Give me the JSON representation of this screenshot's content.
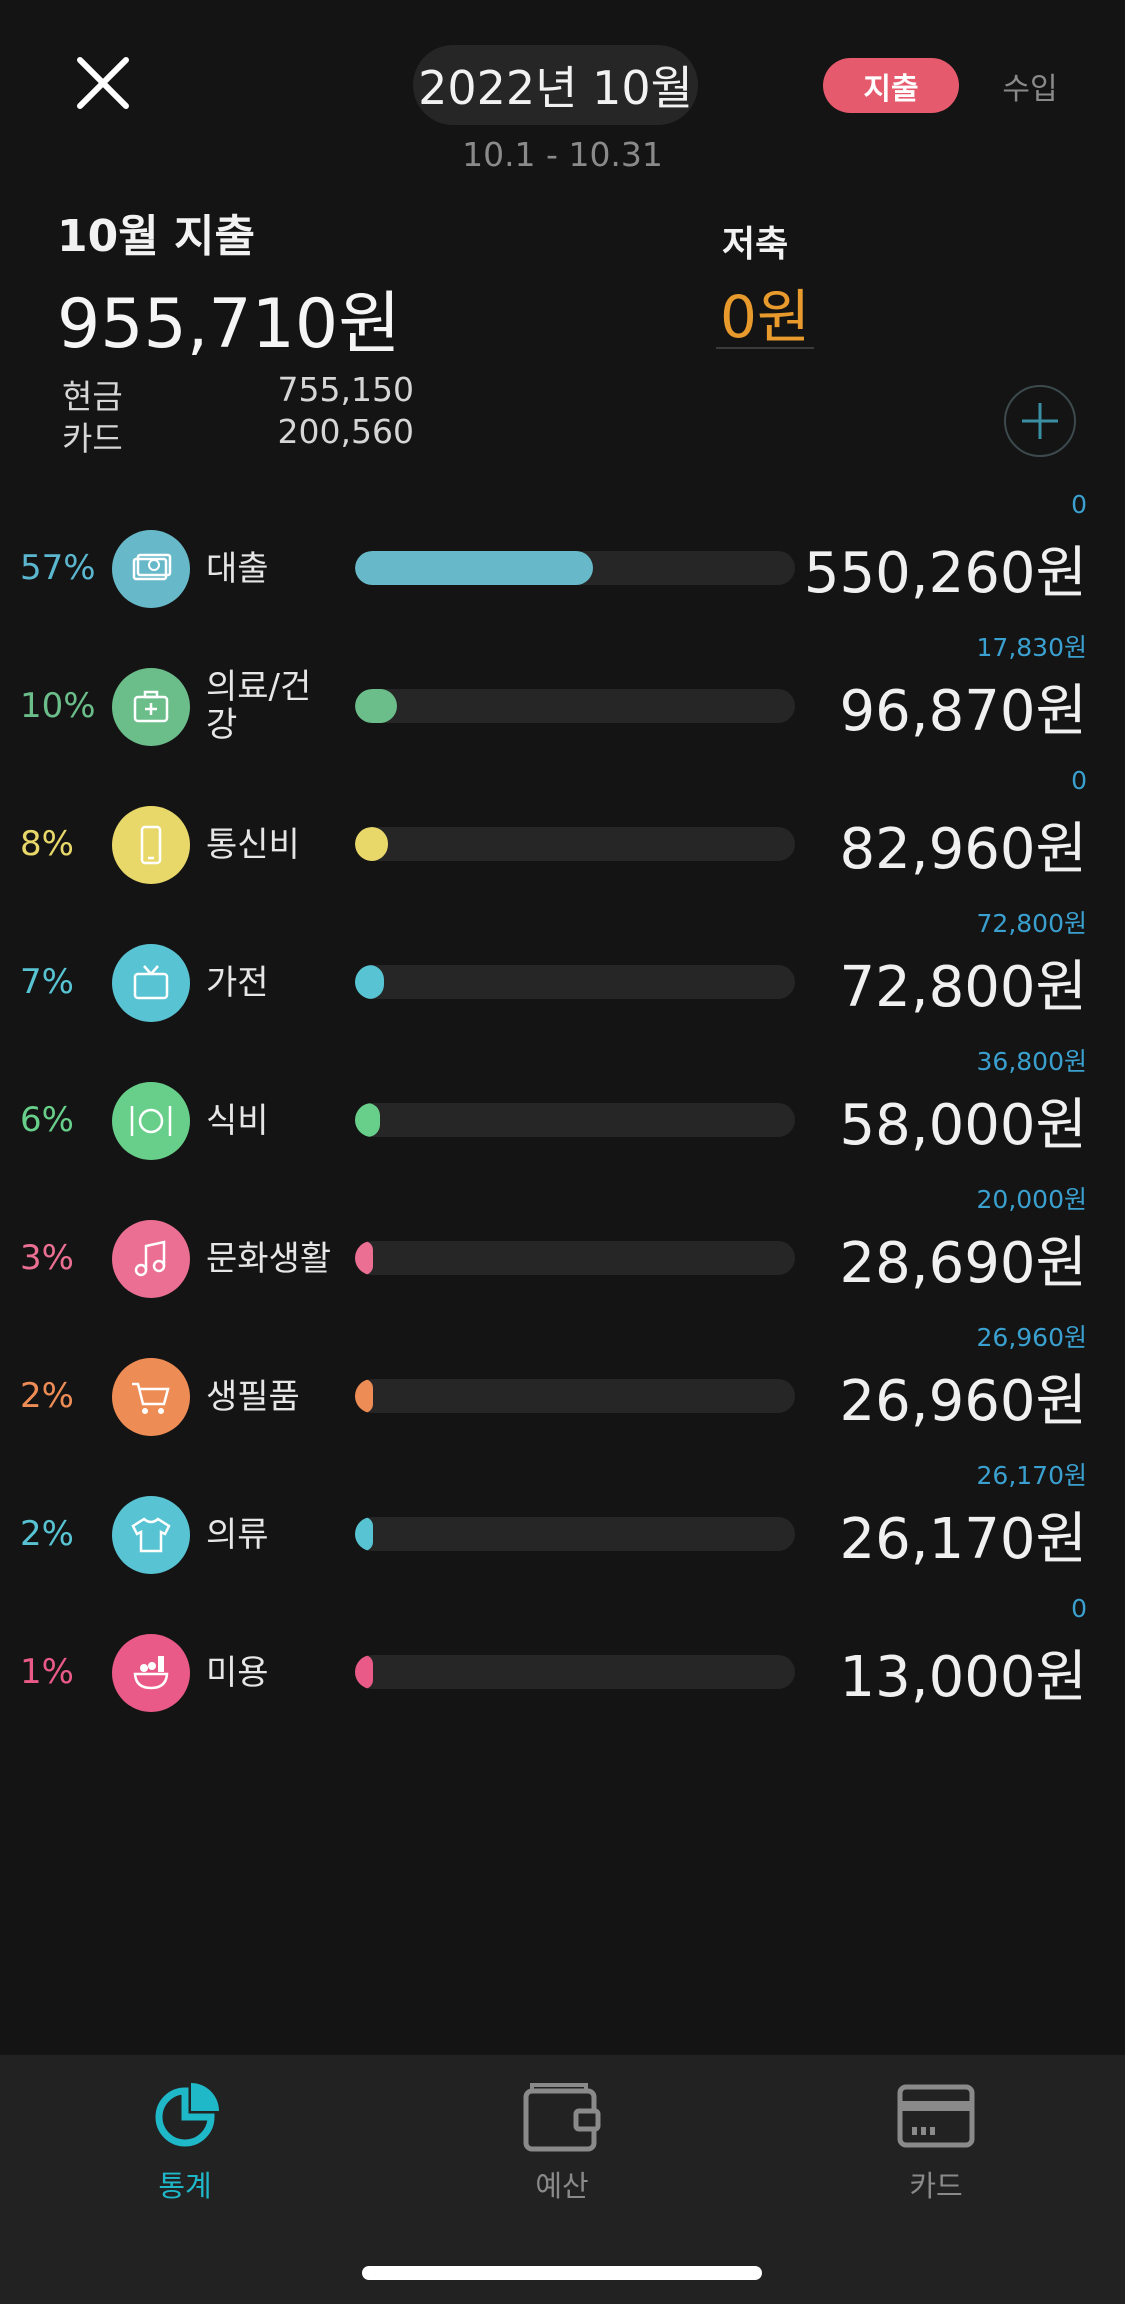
{
  "header": {
    "month": "2022년 10월",
    "date_range": "10.1 - 10.31",
    "tab_expense": "지출",
    "tab_income": "수입"
  },
  "summary": {
    "title": "10월 지출",
    "total": "955,710원",
    "cash_label": "현금",
    "cash_value": "755,150",
    "card_label": "카드",
    "card_value": "200,560",
    "savings_label": "저축",
    "savings_value": "0원"
  },
  "categories": [
    {
      "pct": "57%",
      "name": "대출",
      "budget": "0",
      "amount": "550,260원",
      "share": 0.57,
      "color": "#67b9c9",
      "pct_color": "#5bb6cf",
      "icon": "money-icon"
    },
    {
      "pct": "10%",
      "name": "의료/건강",
      "budget": "17,830원",
      "amount": "96,870원",
      "share": 0.1,
      "color": "#6bbd8a",
      "pct_color": "#6bbd8a",
      "icon": "medical-kit-icon"
    },
    {
      "pct": "8%",
      "name": "통신비",
      "budget": "0",
      "amount": "82,960원",
      "share": 0.08,
      "color": "#e8d86a",
      "pct_color": "#e8d86a",
      "icon": "phone-icon"
    },
    {
      "pct": "7%",
      "name": "가전",
      "budget": "72,800원",
      "amount": "72,800원",
      "share": 0.07,
      "color": "#58c3d3",
      "pct_color": "#58c3d3",
      "icon": "tv-icon"
    },
    {
      "pct": "6%",
      "name": "식비",
      "budget": "36,800원",
      "amount": "58,000원",
      "share": 0.06,
      "color": "#67cf8a",
      "pct_color": "#67cf8a",
      "icon": "dining-icon"
    },
    {
      "pct": "3%",
      "name": "문화생활",
      "budget": "20,000원",
      "amount": "28,690원",
      "share": 0.03,
      "color": "#ea6f92",
      "pct_color": "#ea6f92",
      "icon": "music-icon"
    },
    {
      "pct": "2%",
      "name": "생필품",
      "budget": "26,960원",
      "amount": "26,960원",
      "share": 0.02,
      "color": "#ee8c56",
      "pct_color": "#ee8c56",
      "icon": "cart-icon"
    },
    {
      "pct": "2%",
      "name": "의류",
      "budget": "26,170원",
      "amount": "26,170원",
      "share": 0.02,
      "color": "#58c3d3",
      "pct_color": "#58c3d3",
      "icon": "shirt-icon"
    },
    {
      "pct": "1%",
      "name": "미용",
      "budget": "0",
      "amount": "13,000원",
      "share": 0.01,
      "color": "#ea5a88",
      "pct_color": "#ea5a88",
      "icon": "beauty-icon"
    }
  ],
  "nav": {
    "stats": "통계",
    "budget": "예산",
    "card": "카드"
  },
  "colors": {
    "accent": "#1fb8c9",
    "expense_tab": "#e65a6e",
    "savings": "#e89a2c",
    "budget_text": "#3aa0cf"
  }
}
